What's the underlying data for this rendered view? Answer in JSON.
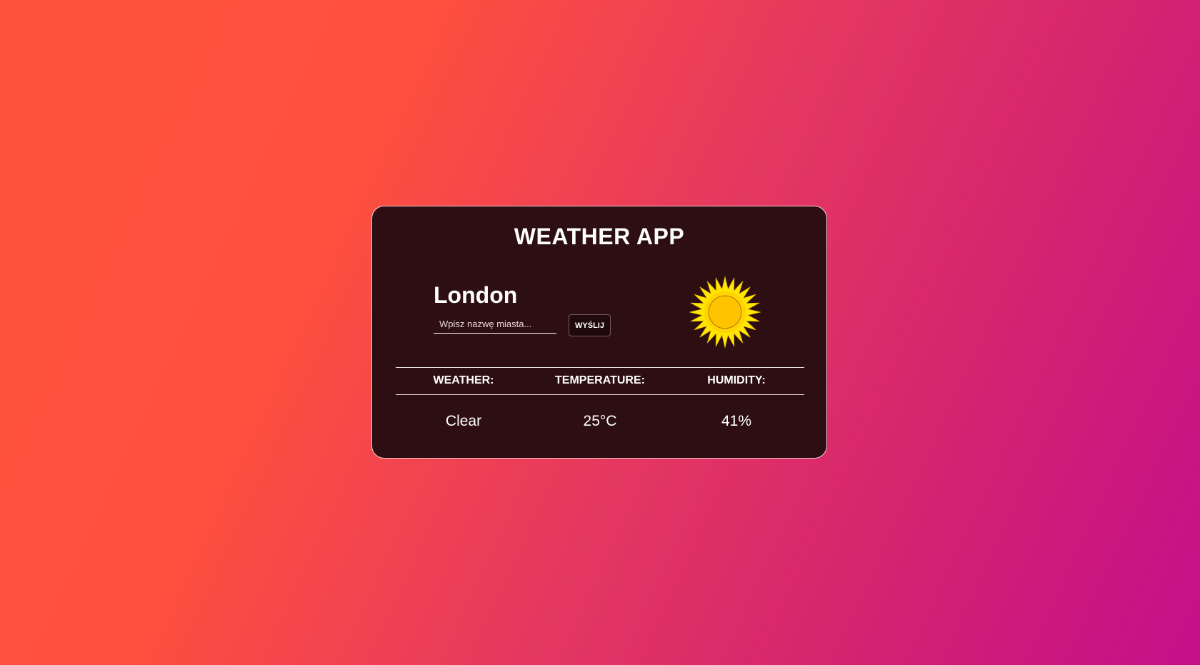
{
  "app": {
    "title": "WEATHER APP"
  },
  "location": {
    "city": "London"
  },
  "search": {
    "placeholder": "Wpisz nazwę miasta...",
    "value": "",
    "submit_label": "WYŚLIJ"
  },
  "weather_icon": {
    "name": "sun-icon",
    "colors": {
      "rays": "#ffe500",
      "body": "#ffc300",
      "outline": "#b07a00"
    }
  },
  "table": {
    "headers": [
      "WEATHER:",
      "TEMPERATURE:",
      "HUMIDITY:"
    ],
    "values": [
      "Clear",
      "25°C",
      "41%"
    ]
  },
  "theme": {
    "gradient_start": "#ff533d",
    "gradient_end": "#c40f8a",
    "card_background": "#2d0e12",
    "text": "#ffffff"
  }
}
